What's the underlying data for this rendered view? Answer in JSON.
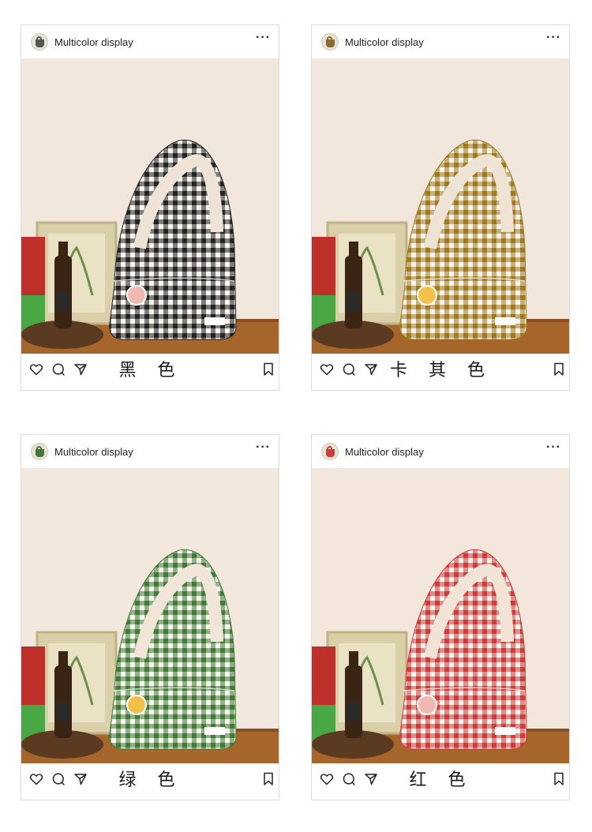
{
  "posts": [
    {
      "username": "Multicolor display",
      "more_label": "···",
      "color_label": "黑 色",
      "bag_color": "#232323",
      "wall_color": "#efe3d6",
      "badge_color": "#f0b8b0"
    },
    {
      "username": "Multicolor display",
      "more_label": "···",
      "color_label": "卡 其 色",
      "bag_color": "#a0781e",
      "wall_color": "#efe3d6",
      "badge_color": "#f2c24a"
    },
    {
      "username": "Multicolor display",
      "more_label": "···",
      "color_label": "绿 色",
      "bag_color": "#3f7a37",
      "wall_color": "#f1e4d8",
      "badge_color": "#f2c04a"
    },
    {
      "username": "Multicolor display",
      "more_label": "···",
      "color_label": "红 色",
      "bag_color": "#cf3a3a",
      "wall_color": "#f1e3d6",
      "badge_color": "#f0b8b0"
    }
  ],
  "icons": [
    "heart-icon",
    "comment-icon",
    "share-icon",
    "bookmark-icon"
  ]
}
